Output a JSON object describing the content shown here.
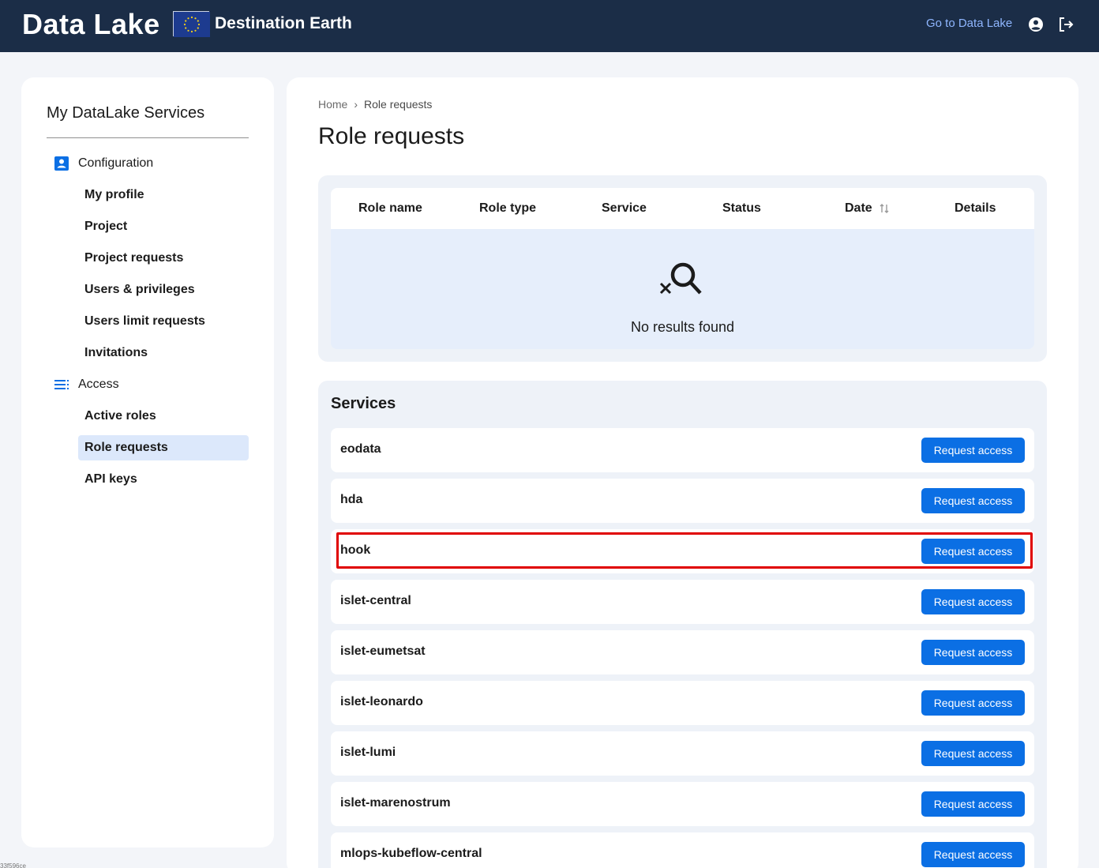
{
  "header": {
    "brand": "Data Lake",
    "partner": "Destination Earth",
    "go_link": "Go to Data Lake",
    "icons": [
      "account-circle-icon",
      "logout-icon"
    ]
  },
  "sidebar": {
    "title": "My DataLake Services",
    "sections": [
      {
        "label": "Configuration",
        "icon": "account-box-icon",
        "items": [
          {
            "label": "My profile"
          },
          {
            "label": "Project"
          },
          {
            "label": "Project requests"
          },
          {
            "label": "Users & privileges"
          },
          {
            "label": "Users limit requests"
          },
          {
            "label": "Invitations"
          }
        ]
      },
      {
        "label": "Access",
        "icon": "list-icon",
        "items": [
          {
            "label": "Active roles"
          },
          {
            "label": "Role requests",
            "active": true
          },
          {
            "label": "API keys"
          }
        ]
      }
    ]
  },
  "main": {
    "breadcrumb": {
      "home": "Home",
      "current": "Role requests"
    },
    "title": "Role requests",
    "table": {
      "columns": [
        "Role name",
        "Role type",
        "Service",
        "Status",
        "Date",
        "Details"
      ],
      "empty_text": "No results found"
    },
    "services": {
      "title": "Services",
      "button_label": "Request access",
      "items": [
        {
          "name": "eodata"
        },
        {
          "name": "hda"
        },
        {
          "name": "hook",
          "highlighted": true
        },
        {
          "name": "islet-central"
        },
        {
          "name": "islet-eumetsat"
        },
        {
          "name": "islet-leonardo"
        },
        {
          "name": "islet-lumi"
        },
        {
          "name": "islet-marenostrum"
        },
        {
          "name": "mlops-kubeflow-central"
        }
      ]
    }
  },
  "colors": {
    "header_bg": "#1b2d47",
    "accent": "#0b6fe4",
    "highlight": "#e00000",
    "active_item_bg": "#dce8fb"
  },
  "footer_text": "33f596ce"
}
